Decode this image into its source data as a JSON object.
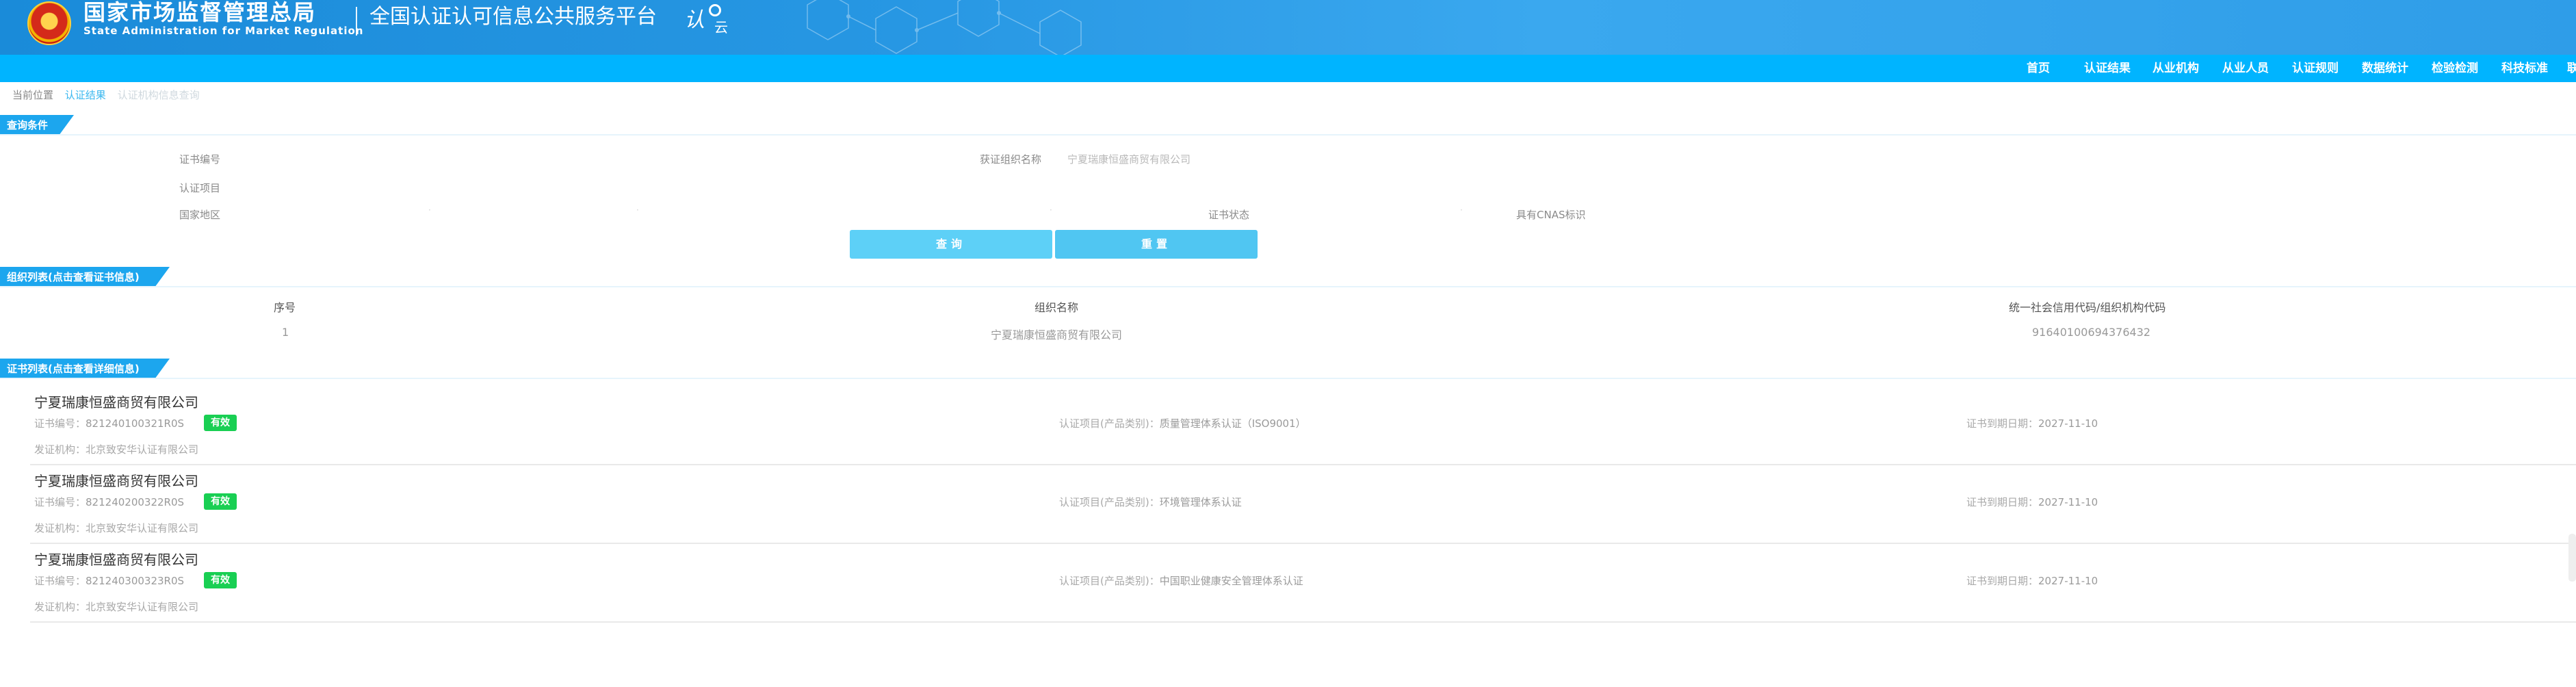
{
  "header": {
    "title_cn": "国家市场监督管理总局",
    "title_en": "State Administration  for  Market Regulation",
    "platform_title": "全国认证认可信息公共服务平台",
    "logo_text_1": "认",
    "logo_text_2": "云"
  },
  "nav": {
    "items": [
      "首页",
      "认证结果",
      "从业机构",
      "从业人员",
      "认证规则",
      "数据统计",
      "检验检测",
      "科技标准",
      "联系"
    ]
  },
  "breadcrumb": {
    "current_location": "当前位置",
    "link": "认证结果",
    "current": "认证机构信息查询"
  },
  "query_section": {
    "tag": "查询条件",
    "cert_no_label": "证书编号",
    "org_name_label": "获证组织名称",
    "org_name_value": "宁夏瑞康恒盛商贸有限公司",
    "cert_item_label": "认证项目",
    "region_label": "国家地区",
    "status_label": "证书状态",
    "cnas_label": "具有CNAS标识",
    "query_button": "查询",
    "reset_button": "重置"
  },
  "org_section": {
    "tag": "组织列表(点击查看证书信息)",
    "headers": [
      "序号",
      "组织名称",
      "统一社会信用代码/组织机构代码"
    ],
    "rows": [
      [
        "1",
        "宁夏瑞康恒盛商贸有限公司",
        "91640100694376432"
      ]
    ]
  },
  "cert_section": {
    "tag": "证书列表(点击查看详细信息)",
    "cert_no_label": "证书编号：",
    "item_label": "认证项目(产品类别)：",
    "expiry_label": "证书到期日期：",
    "issuer_label": "发证机构：",
    "items": [
      {
        "name": "宁夏瑞康恒盛商贸有限公司",
        "cert_no": "821240100321R0S",
        "status": "有效",
        "item": "质量管理体系认证（ISO9001）",
        "expiry": "2027-11-10",
        "issuer": "北京致安华认证有限公司"
      },
      {
        "name": "宁夏瑞康恒盛商贸有限公司",
        "cert_no": "821240200322R0S",
        "status": "有效",
        "item": "环境管理体系认证",
        "expiry": "2027-11-10",
        "issuer": "北京致安华认证有限公司"
      },
      {
        "name": "宁夏瑞康恒盛商贸有限公司",
        "cert_no": "821240300323R0S",
        "status": "有效",
        "item": "中国职业健康安全管理体系认证",
        "expiry": "2027-11-10",
        "issuer": "北京致安华认证有限公司"
      }
    ]
  },
  "colors": {
    "header_blue": "#2797e3",
    "nav_blue": "#00b4ff",
    "tag_blue": "#1ca6ee",
    "badge_green": "#19cf53",
    "button_blue": "#5dd0f7"
  }
}
